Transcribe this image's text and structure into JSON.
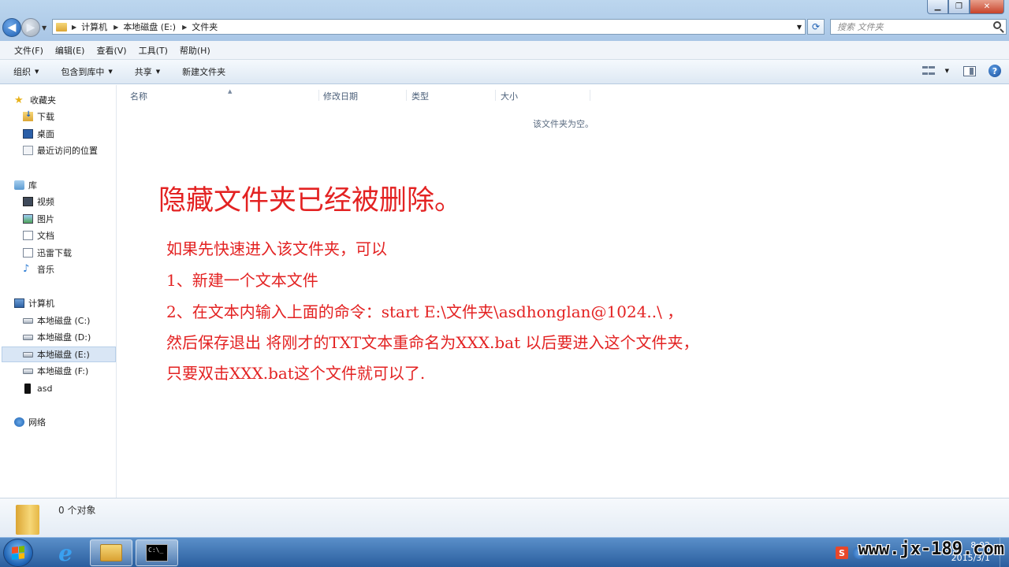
{
  "window": {
    "min_glyph": "▁",
    "max_glyph": "❐",
    "close_glyph": "✕"
  },
  "address": {
    "segments": [
      "计算机",
      "本地磁盘 (E:)",
      "文件夹"
    ]
  },
  "search": {
    "placeholder": "搜索 文件夹"
  },
  "menu": {
    "items": [
      "文件(F)",
      "编辑(E)",
      "查看(V)",
      "工具(T)",
      "帮助(H)"
    ]
  },
  "toolbar": {
    "organize": "组织",
    "include_library": "包含到库中",
    "share": "共享",
    "new_folder": "新建文件夹",
    "help_glyph": "?"
  },
  "nav": {
    "favorites": "收藏夹",
    "downloads": "下载",
    "desktop": "桌面",
    "recent": "最近访问的位置",
    "libraries": "库",
    "videos": "视频",
    "pictures": "图片",
    "documents": "文档",
    "thunder": "迅雷下载",
    "music": "音乐",
    "computer": "计算机",
    "drive_c": "本地磁盘 (C:)",
    "drive_d": "本地磁盘 (D:)",
    "drive_e": "本地磁盘 (E:)",
    "drive_f": "本地磁盘 (F:)",
    "asd": "asd",
    "network": "网络"
  },
  "columns": {
    "name": "名称",
    "modified": "修改日期",
    "type": "类型",
    "size": "大小"
  },
  "content": {
    "empty_message": "该文件夹为空。",
    "title": "隐藏文件夹已经被删除。",
    "lines": [
      "如果先快速进入该文件夹，可以",
      "1、新建一个文本文件",
      "2、在文本内输入上面的命令：start E:\\文件夹\\asdhonglan@1024..\\ ，",
      "然后保存退出 将刚才的TXT文本重命名为XXX.bat 以后要进入这个文件夹，",
      "只要双击XXX.bat这个文件就可以了."
    ]
  },
  "details": {
    "count": "0 个对象"
  },
  "taskbar": {
    "cmd_text": "C:\\_",
    "tray_s": "S",
    "tray_q": "?",
    "clock_time": "8:02",
    "clock_date": "2015/3/1",
    "watermark": "www.jx-189.com"
  },
  "colors": {
    "annotation_red": "#e32222",
    "selection_blue": "#d9e6f5"
  }
}
